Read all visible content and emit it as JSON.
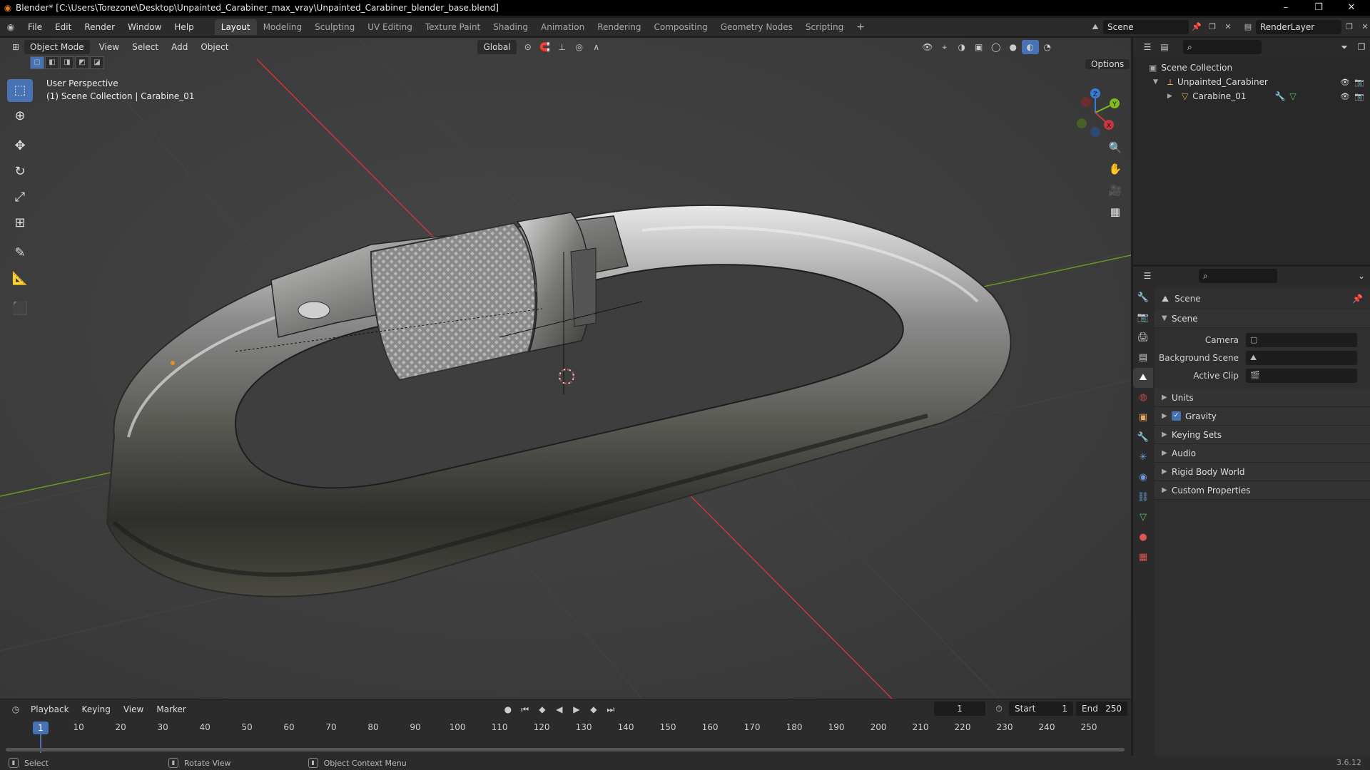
{
  "window": {
    "title": "Blender* [C:\\Users\\Torezone\\Desktop\\Unpainted_Carabiner_max_vray\\Unpainted_Carabiner_blender_base.blend]",
    "controls": {
      "minimize": "–",
      "maximize": "❐",
      "close": "✕"
    }
  },
  "menu": [
    "File",
    "Edit",
    "Render",
    "Window",
    "Help"
  ],
  "workspaces": [
    "Layout",
    "Modeling",
    "Sculpting",
    "UV Editing",
    "Texture Paint",
    "Shading",
    "Animation",
    "Rendering",
    "Compositing",
    "Geometry Nodes",
    "Scripting"
  ],
  "active_workspace": "Layout",
  "scene_selector": "Scene",
  "view_layer": "RenderLayer",
  "viewport": {
    "mode": "Object Mode",
    "menus": [
      "View",
      "Select",
      "Add",
      "Object"
    ],
    "transform_orientation": "Global",
    "options_label": "Options",
    "info_line1": "User Perspective",
    "info_line2": "(1) Scene Collection | Carabine_01",
    "gizmo_axes": {
      "x": "X",
      "y": "Y",
      "z": "Z"
    }
  },
  "timeline": {
    "menus": [
      "Playback",
      "Keying",
      "View",
      "Marker"
    ],
    "current_frame": "1",
    "start_label": "Start",
    "start": "1",
    "end_label": "End",
    "end": "250",
    "ruler": [
      "1",
      "10",
      "20",
      "30",
      "40",
      "50",
      "60",
      "70",
      "80",
      "90",
      "100",
      "110",
      "120",
      "130",
      "140",
      "150",
      "160",
      "170",
      "180",
      "190",
      "200",
      "210",
      "220",
      "230",
      "240",
      "250"
    ]
  },
  "outliner": {
    "root": "Scene Collection",
    "collection": "Unpainted_Carabiner",
    "object": "Carabine_01"
  },
  "properties": {
    "header": "Scene",
    "panel": "Scene",
    "camera_label": "Camera",
    "background_scene_label": "Background Scene",
    "active_clip_label": "Active Clip",
    "sections": [
      "Units",
      "Gravity",
      "Keying Sets",
      "Audio",
      "Rigid Body World",
      "Custom Properties"
    ]
  },
  "statusbar": {
    "select": "Select",
    "rotate": "Rotate View",
    "context": "Object Context Menu",
    "version": "3.6.12"
  },
  "colors": {
    "accent": "#4772b3",
    "x_axis": "#c8373f",
    "y_axis": "#7dbb1f",
    "z_axis": "#3b7bd8",
    "viewport_bg": "#3f3f3f"
  }
}
